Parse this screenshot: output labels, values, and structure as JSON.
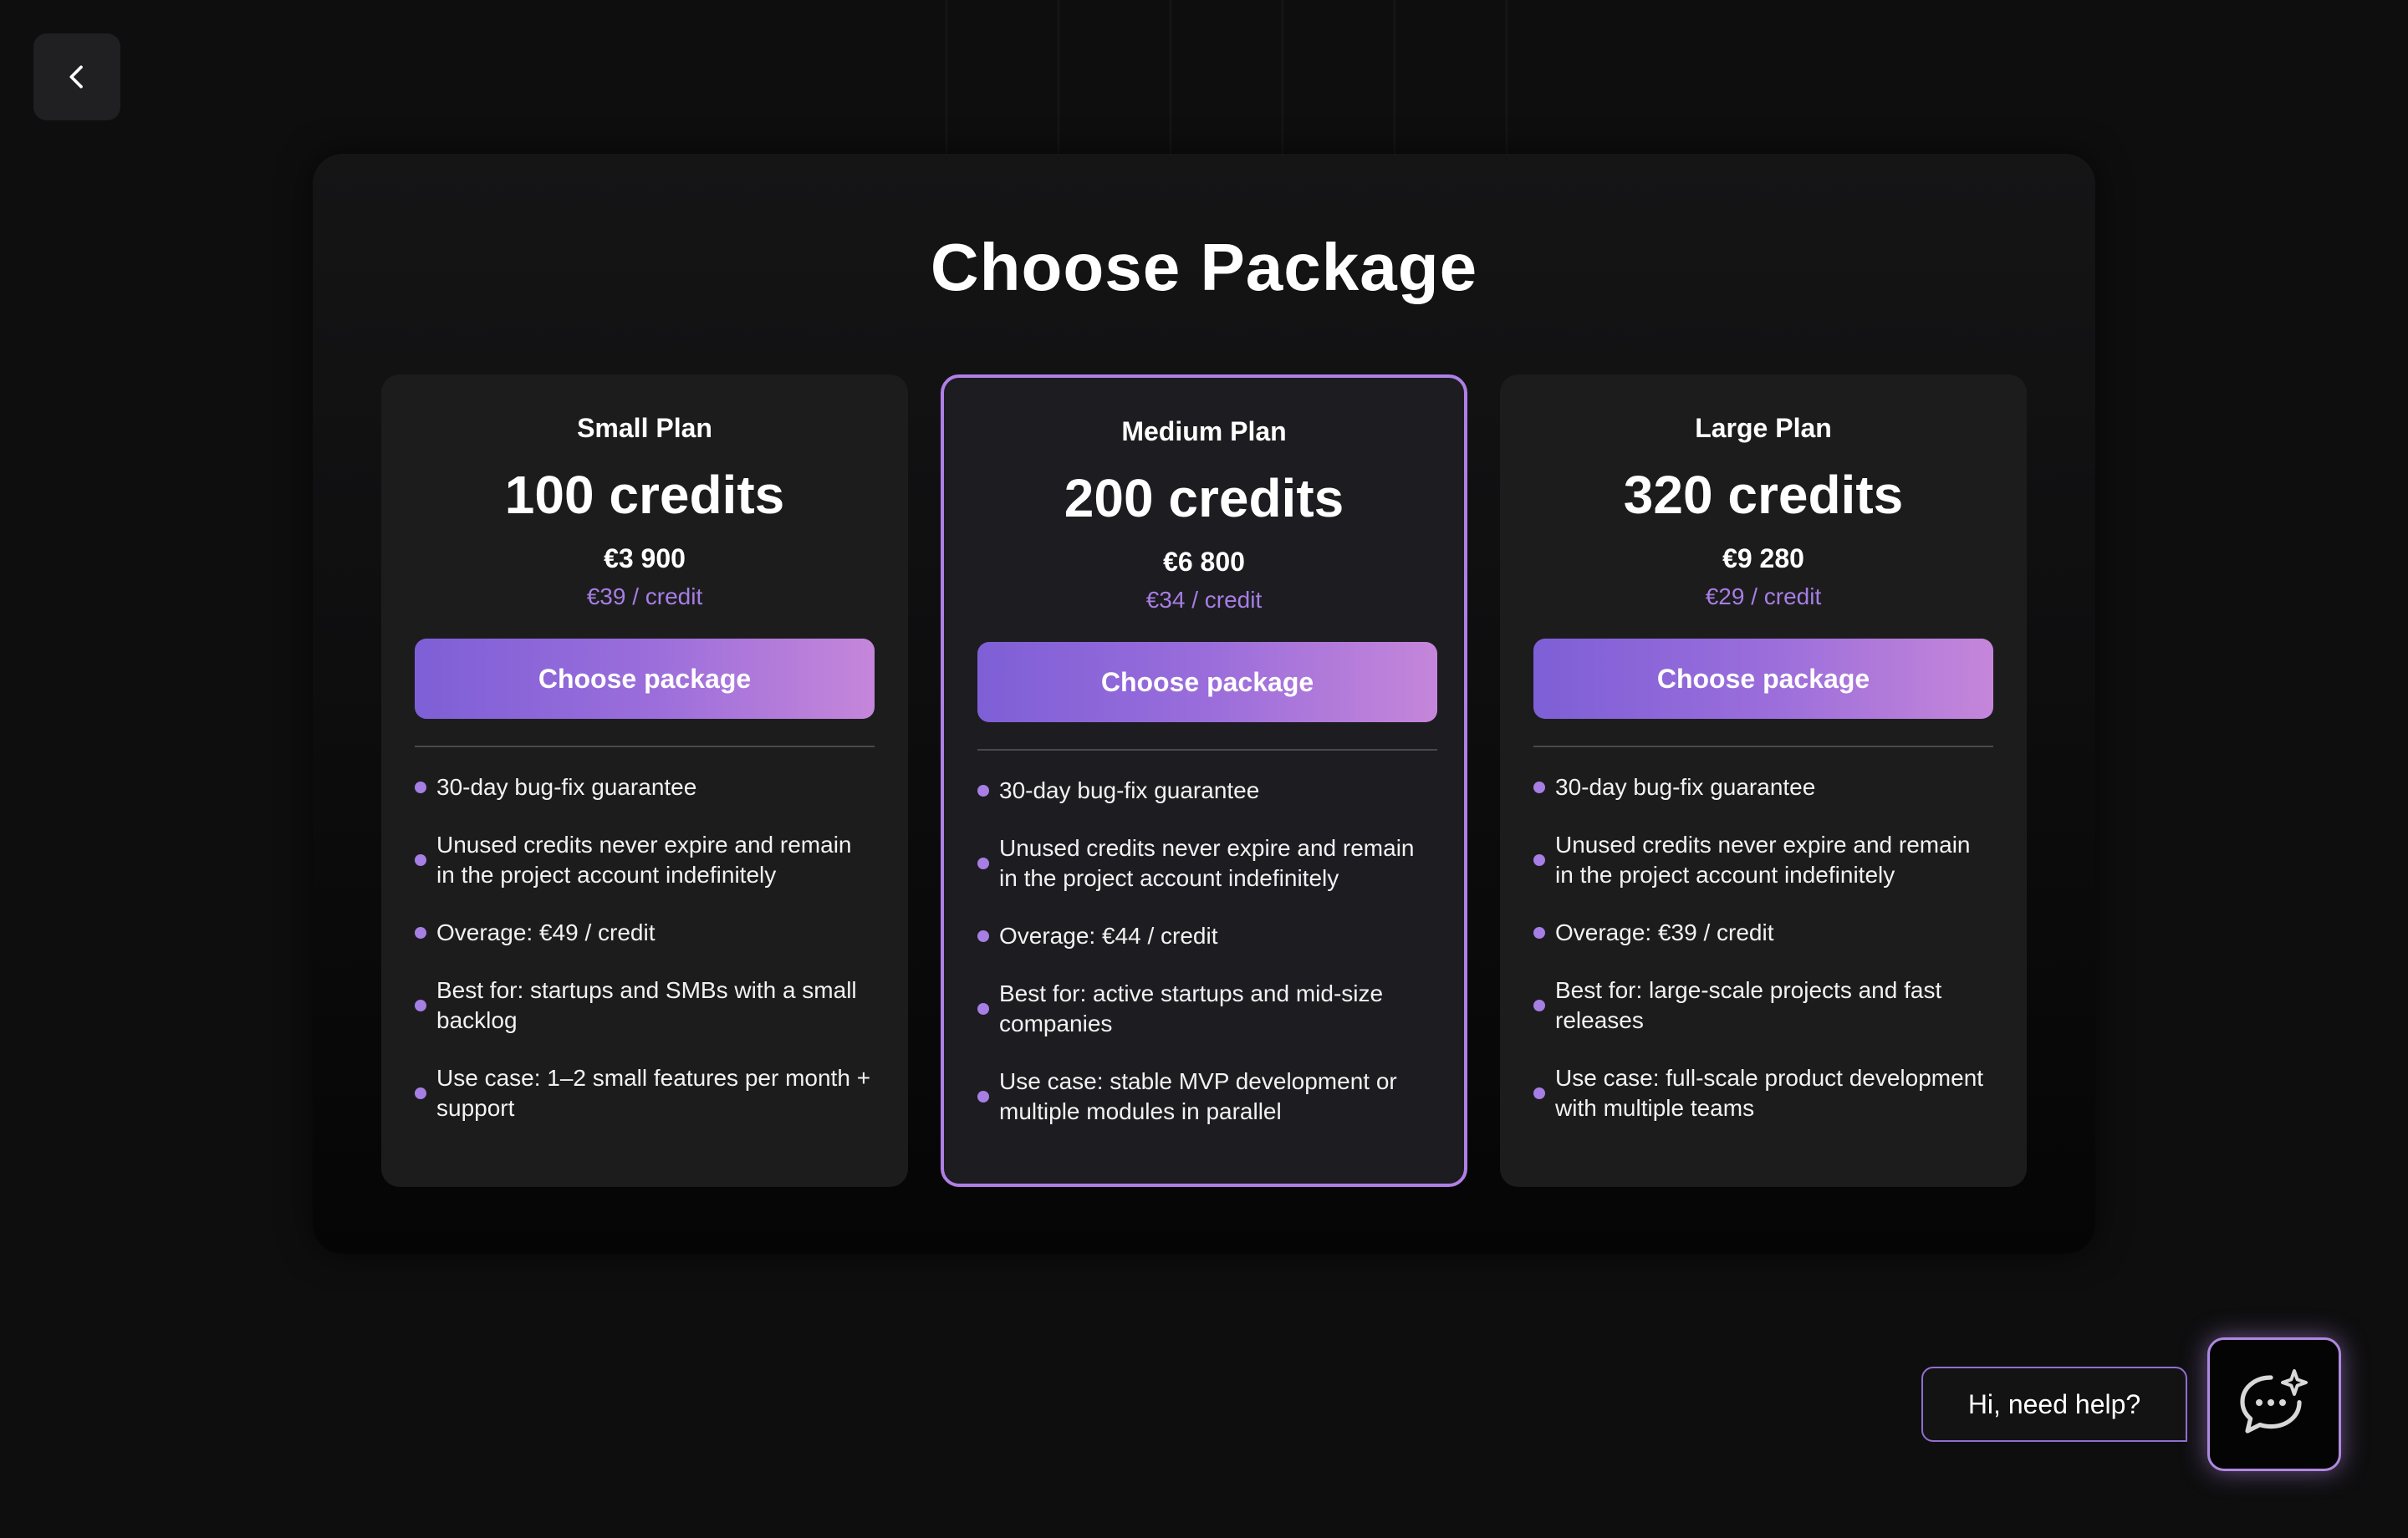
{
  "page": {
    "title": "Choose Package",
    "back_icon": "chevron-left-icon"
  },
  "plans": [
    {
      "name": "Small Plan",
      "credits": "100 credits",
      "price": "€3 900",
      "per_credit": "€39 / credit",
      "button_label": "Choose package",
      "featured": false,
      "features": [
        "30-day bug-fix guarantee",
        "Unused credits never expire and remain in the project account indefinitely",
        "Overage: €49 / credit",
        "Best for: startups and SMBs with a small backlog",
        "Use case: 1–2 small features per month + support"
      ]
    },
    {
      "name": "Medium Plan",
      "credits": "200 credits",
      "price": "€6 800",
      "per_credit": "€34 / credit",
      "button_label": "Choose package",
      "featured": true,
      "features": [
        "30-day bug-fix guarantee",
        "Unused credits never expire and remain in the project account indefinitely",
        "Overage: €44 / credit",
        "Best for: active startups and mid-size companies",
        "Use case: stable MVP development or multiple modules in parallel"
      ]
    },
    {
      "name": "Large Plan",
      "credits": "320 credits",
      "price": "€9 280",
      "per_credit": "€29 / credit",
      "button_label": "Choose package",
      "featured": false,
      "features": [
        "30-day bug-fix guarantee",
        "Unused credits never expire and remain in the project account indefinitely",
        "Overage: €39 / credit",
        "Best for: large-scale projects and fast releases",
        "Use case: full-scale product development with multiple teams"
      ]
    }
  ],
  "help": {
    "bubble_text": "Hi, need help?",
    "chat_icon": "chat-sparkle-icon"
  },
  "colors": {
    "accent": "#a67ee4",
    "button_gradient_start": "#7e5fd6",
    "button_gradient_end": "#c586da",
    "featured_border": "#b07fe6"
  }
}
